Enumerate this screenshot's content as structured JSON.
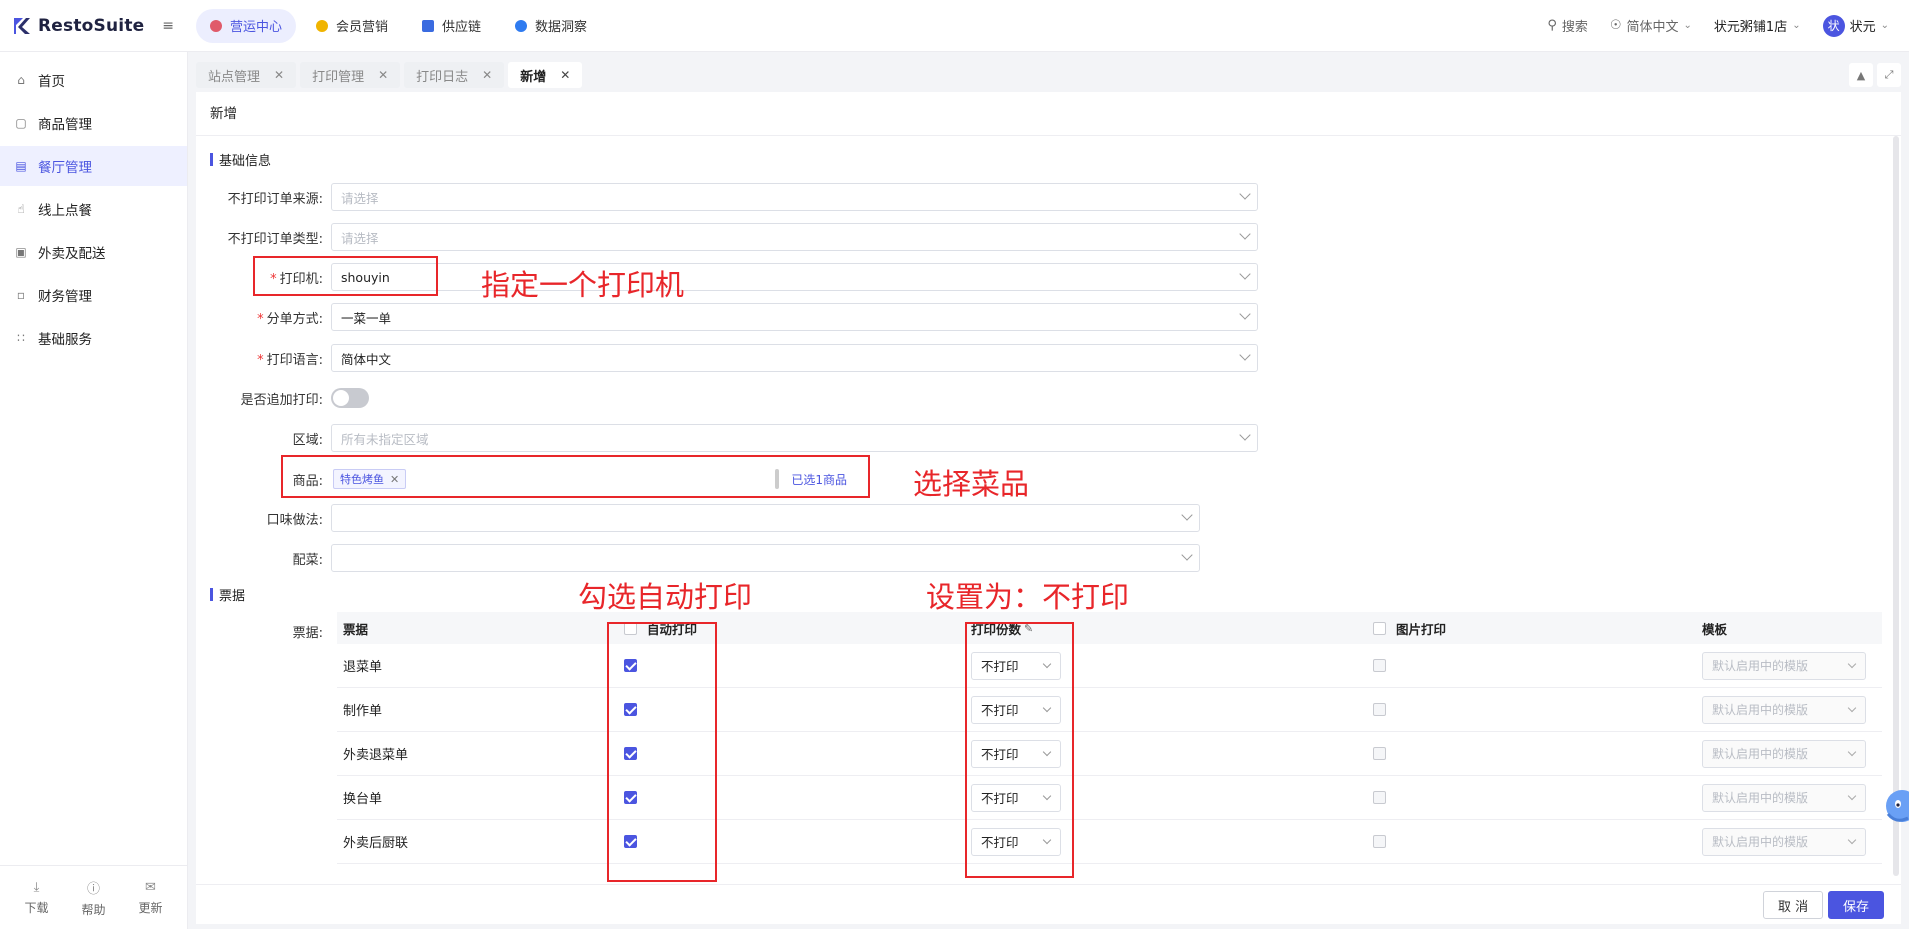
{
  "app": {
    "brand": "RestoSuite"
  },
  "topnav": [
    {
      "label": "营运中心",
      "active": true,
      "color": "#e05a6a"
    },
    {
      "label": "会员营销",
      "active": false,
      "color": "#f0b400"
    },
    {
      "label": "供应链",
      "active": false,
      "color": "#3a6be0"
    },
    {
      "label": "数据洞察",
      "active": false,
      "color": "#2f7bf0"
    }
  ],
  "topright": {
    "search": "搜索",
    "language": "简体中文",
    "store": "状元粥铺1店",
    "user": "状元",
    "avatar_char": "状"
  },
  "sidebar": {
    "items": [
      {
        "label": "首页",
        "icon": "home-icon"
      },
      {
        "label": "商品管理",
        "icon": "box-icon"
      },
      {
        "label": "餐厅管理",
        "icon": "store-icon",
        "active": true
      },
      {
        "label": "线上点餐",
        "icon": "hand-icon"
      },
      {
        "label": "外卖及配送",
        "icon": "bag-icon"
      },
      {
        "label": "财务管理",
        "icon": "folder-icon"
      },
      {
        "label": "基础服务",
        "icon": "grid-icon"
      }
    ],
    "bottom": [
      {
        "label": "下载",
        "icon": "download-icon"
      },
      {
        "label": "帮助",
        "icon": "help-icon"
      },
      {
        "label": "更新",
        "icon": "update-icon"
      }
    ]
  },
  "tabs": [
    {
      "label": "站点管理",
      "active": false
    },
    {
      "label": "打印管理",
      "active": false
    },
    {
      "label": "打印日志",
      "active": false
    },
    {
      "label": "新增",
      "active": true
    }
  ],
  "page": {
    "title": "新增"
  },
  "sections": {
    "basic": "基础信息",
    "tickets": "票据"
  },
  "form": {
    "exclude_source": {
      "label": "不打印订单来源:",
      "placeholder": "请选择"
    },
    "exclude_type": {
      "label": "不打印订单类型:",
      "placeholder": "请选择"
    },
    "printer": {
      "label": "打印机:",
      "value": "shouyin"
    },
    "split_mode": {
      "label": "分单方式:",
      "value": "一菜一单"
    },
    "print_language": {
      "label": "打印语言:",
      "value": "简体中文"
    },
    "append_print": {
      "label": "是否追加打印:",
      "on": false
    },
    "area": {
      "label": "区域:",
      "placeholder": "所有未指定区域"
    },
    "goods": {
      "label": "商品:",
      "tag": "特色烤鱼",
      "selected_count": "已选1商品"
    },
    "flavor": {
      "label": "口味做法:"
    },
    "side_dish": {
      "label": "配菜:"
    }
  },
  "tickets": {
    "label": "票据:",
    "headers": {
      "name": "票据",
      "auto_print": "自动打印",
      "copies": "打印份数",
      "image_print": "图片打印",
      "template": "模板"
    },
    "rows": [
      {
        "name": "退菜单",
        "auto": true,
        "copies": "不打印",
        "image": false,
        "template": "默认启用中的模版"
      },
      {
        "name": "制作单",
        "auto": true,
        "copies": "不打印",
        "image": false,
        "template": "默认启用中的模版"
      },
      {
        "name": "外卖退菜单",
        "auto": true,
        "copies": "不打印",
        "image": false,
        "template": "默认启用中的模版"
      },
      {
        "name": "换台单",
        "auto": true,
        "copies": "不打印",
        "image": false,
        "template": "默认启用中的模版"
      },
      {
        "name": "外卖后厨联",
        "auto": true,
        "copies": "不打印",
        "image": false,
        "template": "默认启用中的模版"
      }
    ]
  },
  "footer": {
    "cancel": "取 消",
    "save": "保存"
  },
  "annotations": {
    "printer": "指定一个打印机",
    "goods": "选择菜品",
    "auto_print": "勾选自动打印",
    "copies": "设置为：不打印"
  },
  "colors": {
    "accent": "#4b55e0",
    "annotation": "#e8262a"
  }
}
